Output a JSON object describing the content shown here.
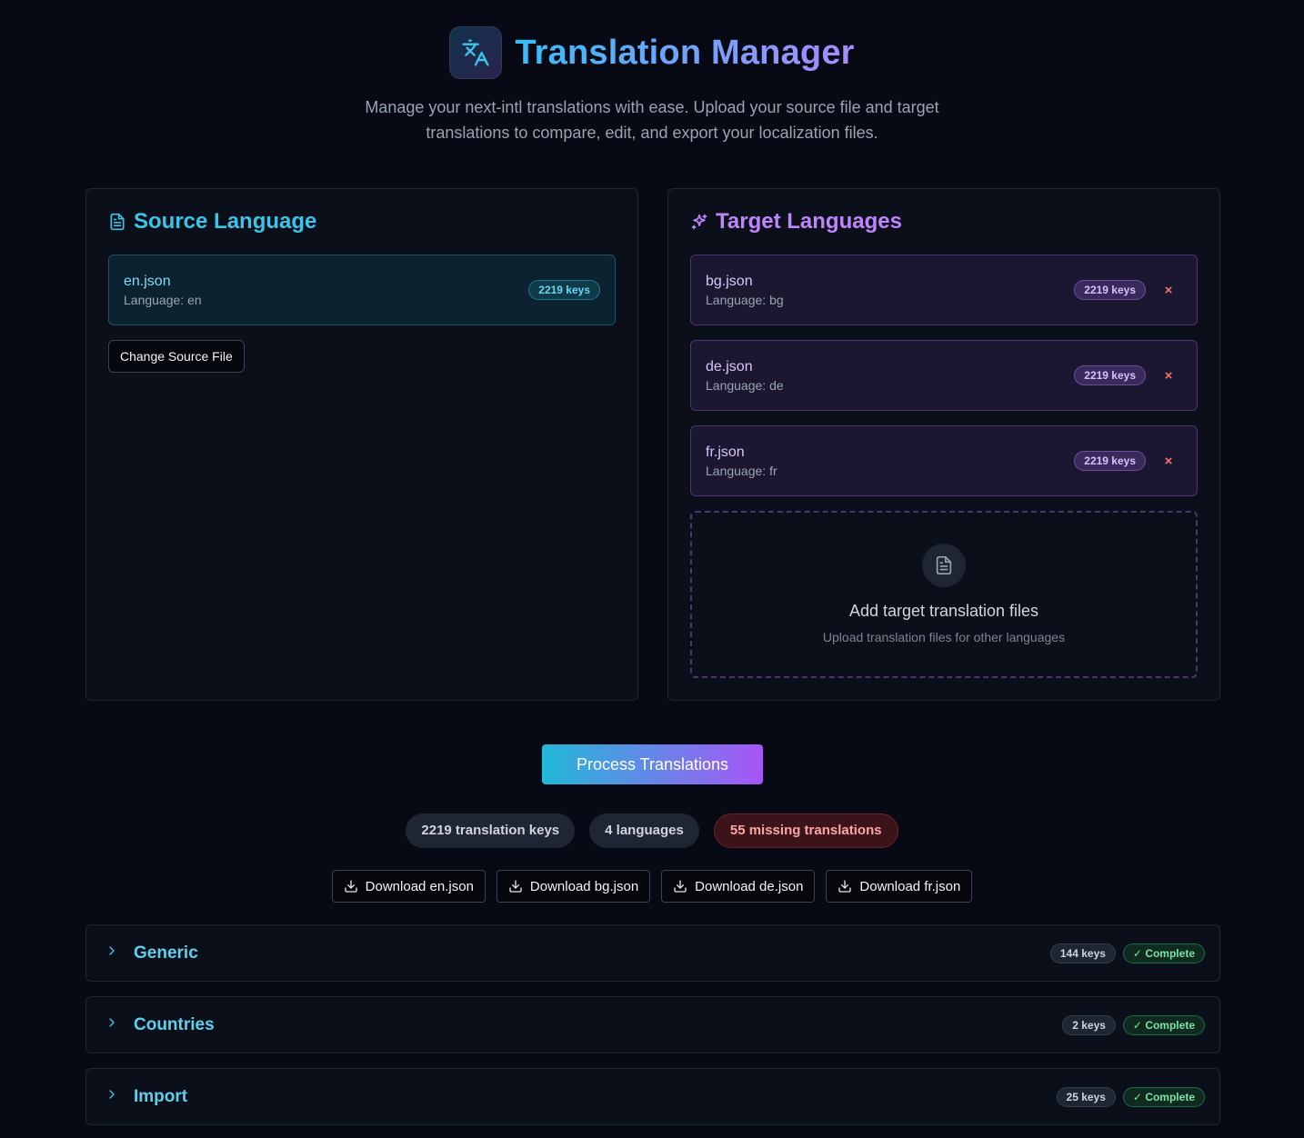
{
  "header": {
    "title": "Translation Manager",
    "subtitle": "Manage your next-intl translations with ease. Upload your source file and target translations to compare, edit, and export your localization files."
  },
  "source": {
    "title": "Source Language",
    "icon": "file-text-icon",
    "file": {
      "name": "en.json",
      "language": "Language: en",
      "keys": "2219 keys"
    },
    "change_label": "Change Source File"
  },
  "target": {
    "title": "Target Languages",
    "icon": "sparkles-icon",
    "files": [
      {
        "name": "bg.json",
        "language": "Language: bg",
        "keys": "2219 keys",
        "remove": "×"
      },
      {
        "name": "de.json",
        "language": "Language: de",
        "keys": "2219 keys",
        "remove": "×"
      },
      {
        "name": "fr.json",
        "language": "Language: fr",
        "keys": "2219 keys",
        "remove": "×"
      }
    ],
    "dropzone": {
      "title": "Add target translation files",
      "subtitle": "Upload translation files for other languages"
    }
  },
  "process_label": "Process Translations",
  "stats": {
    "keys": "2219 translation keys",
    "languages": "4 languages",
    "missing": "55 missing translations"
  },
  "downloads": [
    "Download en.json",
    "Download bg.json",
    "Download de.json",
    "Download fr.json"
  ],
  "sections": [
    {
      "title": "Generic",
      "keys": "144 keys",
      "status": "Complete"
    },
    {
      "title": "Countries",
      "keys": "2 keys",
      "status": "Complete"
    },
    {
      "title": "Import",
      "keys": "25 keys",
      "status": "Complete"
    }
  ],
  "colors": {
    "background": "#070a14",
    "source_accent": "#3cc4e8",
    "target_accent": "#c084fc",
    "missing": "#fca5a5",
    "complete": "#7be3a8"
  }
}
